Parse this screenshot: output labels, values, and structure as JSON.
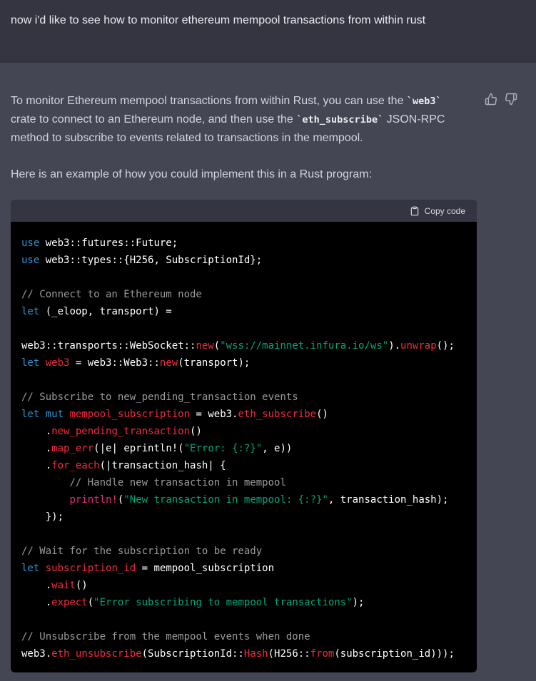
{
  "user": {
    "message": "now i'd like to see how to monitor ethereum mempool transactions from within rust"
  },
  "assistant": {
    "p1_pre": "To monitor Ethereum mempool transactions from within Rust, you can use the ",
    "p1_code1": "`web3`",
    "p1_mid": " crate to connect to an Ethereum node, and then use the ",
    "p1_code2": "`eth_subscribe`",
    "p1_post": " JSON-RPC method to subscribe to events related to transactions in the mempool.",
    "p2": "Here is an example of how you could implement this in a Rust program:",
    "feedback": {
      "thumbs_up_icon": "thumbs-up-icon",
      "thumbs_down_icon": "thumbs-down-icon"
    },
    "code_block": {
      "copy_label": "Copy code",
      "copy_icon": "clipboard-icon",
      "language": "rust",
      "lines": [
        [
          [
            "kw",
            "use"
          ],
          [
            "p",
            " web3::futures::Future;"
          ]
        ],
        [
          [
            "kw",
            "use"
          ],
          [
            "p",
            " web3::types::{H256, SubscriptionId};"
          ]
        ],
        [],
        [
          [
            "cm",
            "// Connect to an Ethereum node"
          ]
        ],
        [
          [
            "kw",
            "let"
          ],
          [
            "p",
            " (_eloop, transport) ="
          ]
        ],
        [],
        [
          [
            "p",
            "web3::transports::WebSocket::"
          ],
          [
            "fn",
            "new"
          ],
          [
            "p",
            "("
          ],
          [
            "str",
            "\"wss://mainnet.infura.io/ws\""
          ],
          [
            "p",
            ")."
          ],
          [
            "fn",
            "unwrap"
          ],
          [
            "p",
            "();"
          ]
        ],
        [
          [
            "kw",
            "let"
          ],
          [
            "p",
            " "
          ],
          [
            "fn",
            "web3"
          ],
          [
            "p",
            " = web3::Web3::"
          ],
          [
            "fn",
            "new"
          ],
          [
            "p",
            "(transport);"
          ]
        ],
        [],
        [
          [
            "cm",
            "// Subscribe to new_pending_transaction events"
          ]
        ],
        [
          [
            "kw",
            "let"
          ],
          [
            "p",
            " "
          ],
          [
            "kw",
            "mut"
          ],
          [
            "p",
            " "
          ],
          [
            "fn",
            "mempool_subscription"
          ],
          [
            "p",
            " = web3."
          ],
          [
            "fn",
            "eth_subscribe"
          ],
          [
            "p",
            "()"
          ]
        ],
        [
          [
            "p",
            "    ."
          ],
          [
            "fn",
            "new_pending_transaction"
          ],
          [
            "p",
            "()"
          ]
        ],
        [
          [
            "p",
            "    ."
          ],
          [
            "fn",
            "map_err"
          ],
          [
            "p",
            "(|e| eprintln!("
          ],
          [
            "str",
            "\"Error: {:?}\""
          ],
          [
            "p",
            ", e))"
          ]
        ],
        [
          [
            "p",
            "    ."
          ],
          [
            "fn",
            "for_each"
          ],
          [
            "p",
            "(|transaction_hash| {"
          ]
        ],
        [
          [
            "p",
            "        "
          ],
          [
            "cm",
            "// Handle new transaction in mempool"
          ]
        ],
        [
          [
            "p",
            "        "
          ],
          [
            "mac",
            "println!"
          ],
          [
            "p",
            "("
          ],
          [
            "str",
            "\"New transaction in mempool: {:?}\""
          ],
          [
            "p",
            ", transaction_hash);"
          ]
        ],
        [
          [
            "p",
            "    });"
          ]
        ],
        [],
        [
          [
            "cm",
            "// Wait for the subscription to be ready"
          ]
        ],
        [
          [
            "kw",
            "let"
          ],
          [
            "p",
            " "
          ],
          [
            "fn",
            "subscription_id"
          ],
          [
            "p",
            " = mempool_subscription"
          ]
        ],
        [
          [
            "p",
            "    ."
          ],
          [
            "fn",
            "wait"
          ],
          [
            "p",
            "()"
          ]
        ],
        [
          [
            "p",
            "    ."
          ],
          [
            "fn",
            "expect"
          ],
          [
            "p",
            "("
          ],
          [
            "str",
            "\"Error subscribing to mempool transactions\""
          ],
          [
            "p",
            ");"
          ]
        ],
        [],
        [
          [
            "cm",
            "// Unsubscribe from the mempool events when done"
          ]
        ],
        [
          [
            "p",
            "web3."
          ],
          [
            "fn",
            "eth_unsubscribe"
          ],
          [
            "p",
            "(SubscriptionId::"
          ],
          [
            "fn",
            "Hash"
          ],
          [
            "p",
            "(H256::"
          ],
          [
            "fn",
            "from"
          ],
          [
            "p",
            "(subscription_id)));"
          ]
        ]
      ]
    }
  },
  "colors": {
    "page_bg": "#444654",
    "user_bg": "#343541",
    "code_bg": "#000000",
    "code_header_bg": "#343541",
    "keyword": "#2e95d3",
    "function": "#f22c3d",
    "string": "#00a67d",
    "comment": "#9a9a9a"
  }
}
